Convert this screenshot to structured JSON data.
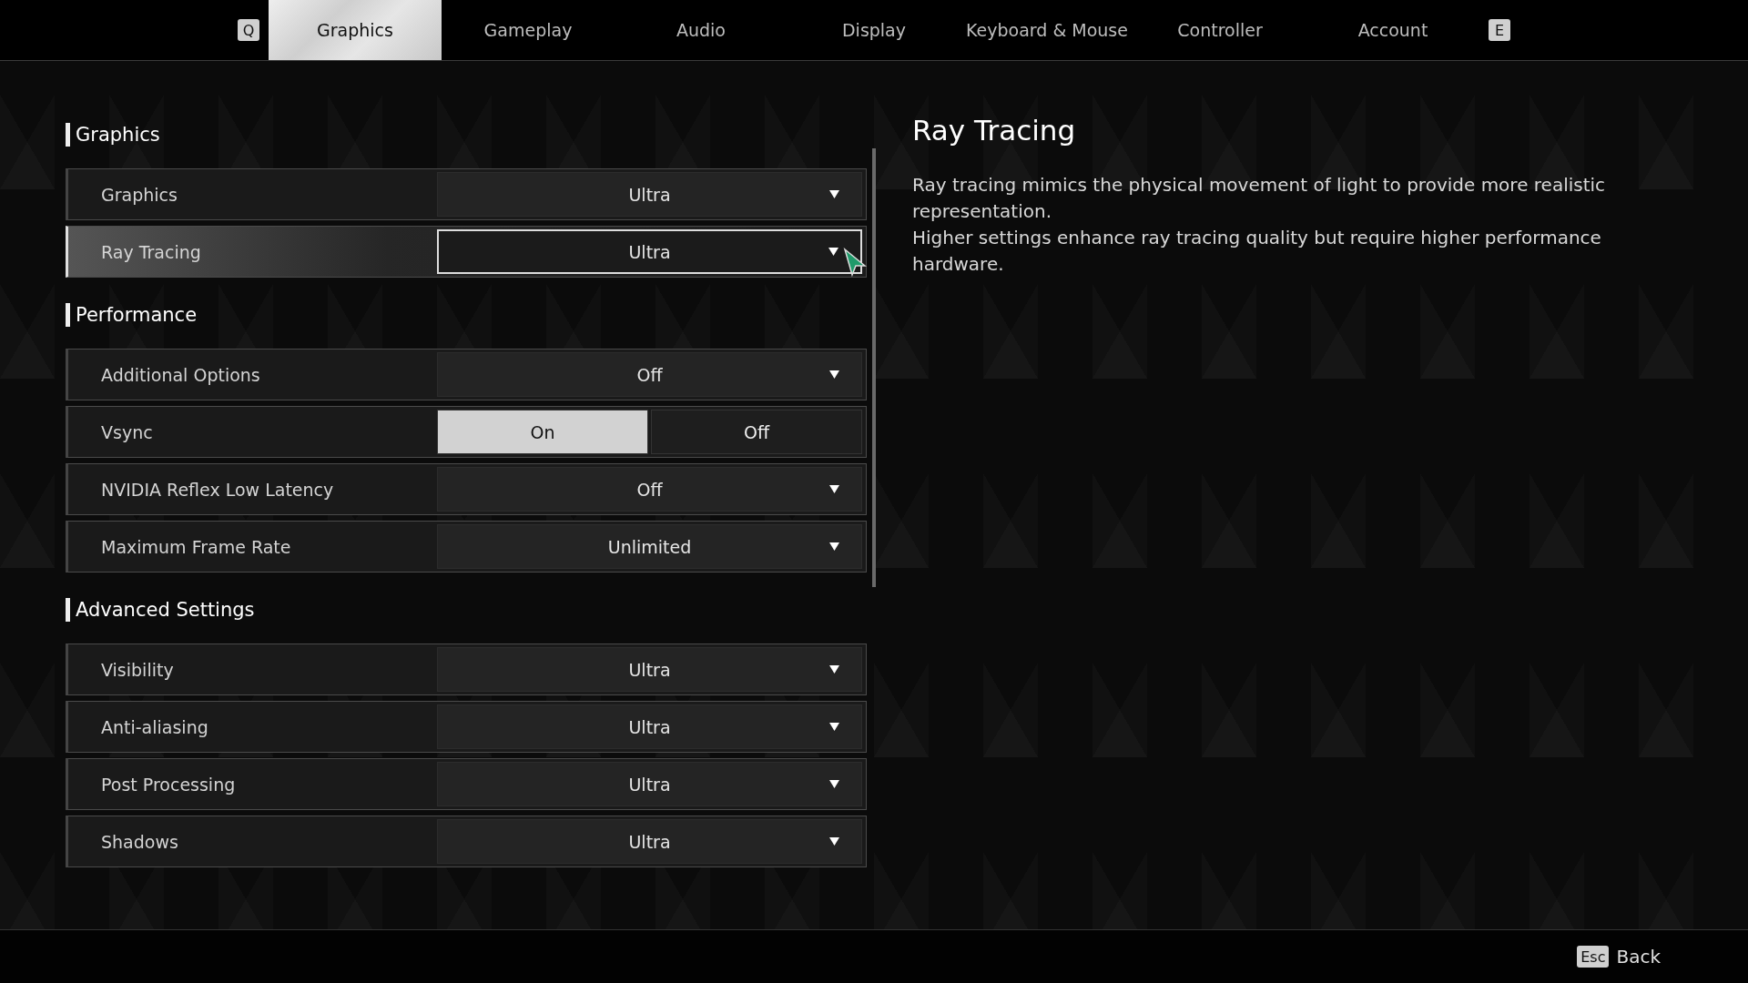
{
  "tabs": {
    "prev_key": "Q",
    "next_key": "E",
    "items": [
      {
        "label": "Graphics",
        "selected": true
      },
      {
        "label": "Gameplay",
        "selected": false
      },
      {
        "label": "Audio",
        "selected": false
      },
      {
        "label": "Display",
        "selected": false
      },
      {
        "label": "Keyboard & Mouse",
        "selected": false
      },
      {
        "label": "Controller",
        "selected": false
      },
      {
        "label": "Account",
        "selected": false
      }
    ]
  },
  "sections": [
    {
      "title": "Graphics",
      "settings": [
        {
          "kind": "dropdown",
          "label": "Graphics",
          "value": "Ultra",
          "focused": false
        },
        {
          "kind": "dropdown",
          "label": "Ray Tracing",
          "value": "Ultra",
          "focused": true
        }
      ]
    },
    {
      "title": "Performance",
      "settings": [
        {
          "kind": "dropdown",
          "label": "Additional Options",
          "value": "Off",
          "focused": false
        },
        {
          "kind": "toggle",
          "label": "Vsync",
          "focused": false,
          "options": [
            {
              "label": "On",
              "selected": true
            },
            {
              "label": "Off",
              "selected": false
            }
          ]
        },
        {
          "kind": "dropdown",
          "label": "NVIDIA Reflex Low Latency",
          "value": "Off",
          "focused": false
        },
        {
          "kind": "dropdown",
          "label": "Maximum Frame Rate",
          "value": "Unlimited",
          "focused": false
        }
      ]
    },
    {
      "title": "Advanced Settings",
      "settings": [
        {
          "kind": "dropdown",
          "label": "Visibility",
          "value": "Ultra",
          "focused": false
        },
        {
          "kind": "dropdown",
          "label": "Anti-aliasing",
          "value": "Ultra",
          "focused": false
        },
        {
          "kind": "dropdown",
          "label": "Post Processing",
          "value": "Ultra",
          "focused": false
        },
        {
          "kind": "dropdown",
          "label": "Shadows",
          "value": "Ultra",
          "focused": false
        }
      ]
    }
  ],
  "detail": {
    "title": "Ray Tracing",
    "paragraphs": [
      "Ray tracing mimics the physical movement of light to provide more realistic representation.",
      "Higher settings enhance ray tracing quality but require higher performance hardware."
    ]
  },
  "footer": {
    "key": "Esc",
    "label": "Back"
  }
}
